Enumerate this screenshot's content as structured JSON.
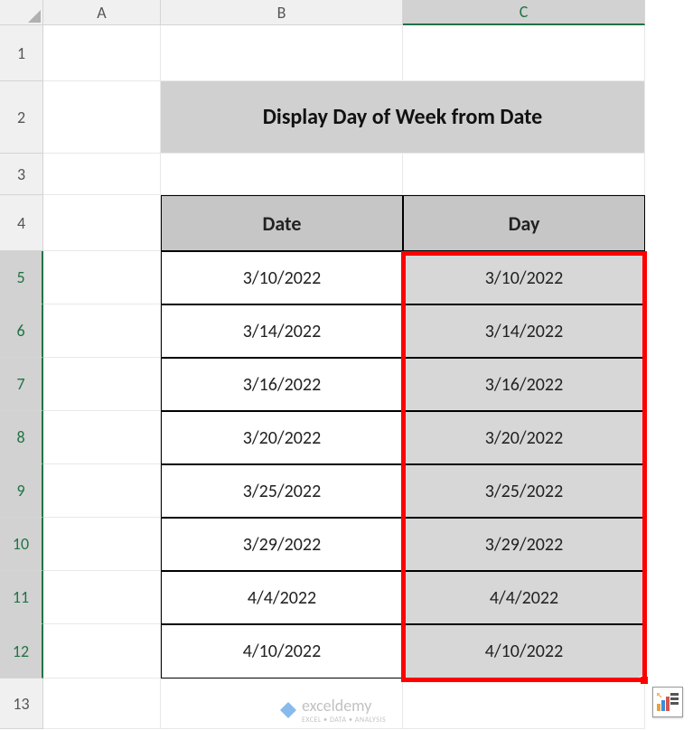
{
  "columns": [
    "A",
    "B",
    "C"
  ],
  "rows": [
    "1",
    "2",
    "3",
    "4",
    "5",
    "6",
    "7",
    "8",
    "9",
    "10",
    "11",
    "12",
    "13"
  ],
  "active_column": "C",
  "selected_rows": [
    "5",
    "6",
    "7",
    "8",
    "9",
    "10",
    "11",
    "12"
  ],
  "title": "Display Day of Week from Date",
  "headers": {
    "date": "Date",
    "day": "Day"
  },
  "data": [
    {
      "date": "3/10/2022",
      "day": "3/10/2022"
    },
    {
      "date": "3/14/2022",
      "day": "3/14/2022"
    },
    {
      "date": "3/16/2022",
      "day": "3/16/2022"
    },
    {
      "date": "3/20/2022",
      "day": "3/20/2022"
    },
    {
      "date": "3/25/2022",
      "day": "3/25/2022"
    },
    {
      "date": "3/29/2022",
      "day": "3/29/2022"
    },
    {
      "date": "4/4/2022",
      "day": "4/4/2022"
    },
    {
      "date": "4/10/2022",
      "day": "4/10/2022"
    }
  ],
  "watermark": {
    "brand": "exceldemy",
    "tagline": "EXCEL • DATA • ANALYSIS"
  },
  "icons": {
    "quick_analysis": "quick-analysis-icon"
  },
  "selection": {
    "range": "C5:C12",
    "color": "#ff0000"
  }
}
